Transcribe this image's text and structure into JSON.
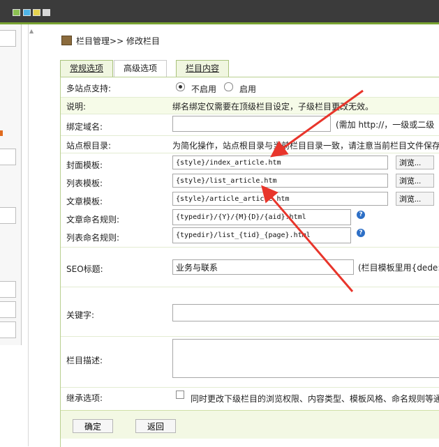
{
  "breadcrumb": {
    "root": "栏目管理",
    "separator": ">>",
    "current": "修改栏目"
  },
  "tabs": [
    {
      "label": "常规选项"
    },
    {
      "label": "高级选项"
    },
    {
      "label": "栏目内容"
    }
  ],
  "form": {
    "multisite": {
      "label": "多站点支持:",
      "option_off": "不启用",
      "option_on": "启用",
      "selected": "不启用"
    },
    "note": {
      "label": "说明:",
      "text": "绑名绑定仅需要在顶级栏目设定，子级栏目更改无效。"
    },
    "bind_domain": {
      "label": "绑定域名:",
      "value": "",
      "hint": "(需加 http://，一级或二级"
    },
    "site_root": {
      "label": "站点根目录:",
      "text": "为简化操作，站点根目录与当前栏目目录一致，请注意当前栏目文件保存"
    },
    "cover_template": {
      "label": "封面模板:",
      "value": "{style}/index_article.htm",
      "browse": "浏览..."
    },
    "list_template": {
      "label": "列表模板:",
      "value": "{style}/list_article.htm",
      "browse": "浏览..."
    },
    "article_template": {
      "label": "文章模板:",
      "value": "{style}/article_article.htm",
      "browse": "浏览..."
    },
    "article_naming": {
      "label": "文章命名规则:",
      "value": "{typedir}/{Y}/{M}{D}/{aid}.html",
      "help": "?"
    },
    "list_naming": {
      "label": "列表命名规则:",
      "value": "{typedir}/list_{tid}_{page}.html",
      "help": "?"
    },
    "seo_title": {
      "label": "SEO标题:",
      "value": "业务与联系",
      "hint": "(栏目模板里用{dede:f"
    },
    "keywords": {
      "label": "关键字:",
      "value": ""
    },
    "description": {
      "label": "栏目描述:",
      "value": ""
    },
    "inherit": {
      "label": "继承选项:",
      "text": "同时更改下级栏目的浏览权限、内容类型、模板风格、命名规则等通"
    }
  },
  "buttons": {
    "confirm": "确定",
    "back": "返回"
  },
  "colors": {
    "topbar": "#3b3b3b",
    "accent_green": "#79a332",
    "arrow_red": "#e8352b",
    "help_blue": "#2d6fc6"
  }
}
